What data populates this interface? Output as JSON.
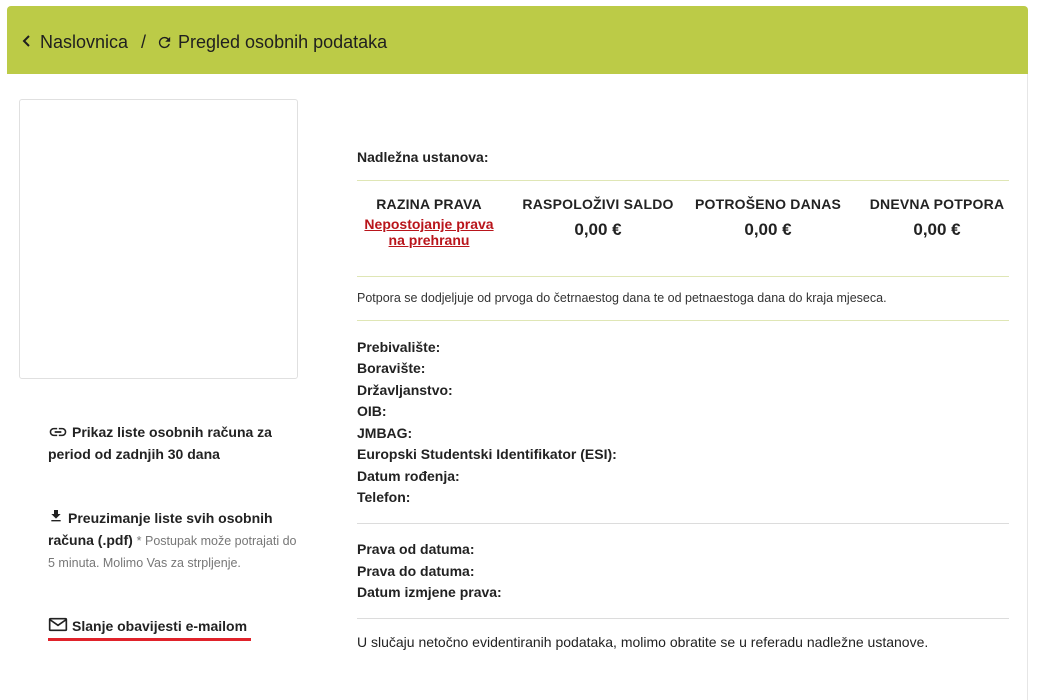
{
  "breadcrumb": {
    "home": "Naslovnica",
    "separator": "/",
    "current": "Pregled osobnih podataka"
  },
  "colors": {
    "header_bg": "#bccb47",
    "accent_red": "#b9151b"
  },
  "sidebar": {
    "link1": "Prikaz liste osobnih računa za period od zadnjih 30 dana",
    "link2": "Preuzimanje liste svih osobnih računa (.pdf)",
    "link2_note": "* Postupak može potrajati do 5 minuta. Molimo Vas za strpljenje.",
    "link3": "Slanje obavijesti e-mailom"
  },
  "main": {
    "institution_label": "Nadležna ustanova:",
    "columns": [
      {
        "title": "RAZINA PRAVA",
        "value": "Nepostojanje prava na prehranu"
      },
      {
        "title": "RASPOLOŽIVI SALDO",
        "value": "0,00 €"
      },
      {
        "title": "POTROŠENO DANAS",
        "value": "0,00 €"
      },
      {
        "title": "DNEVNA POTPORA",
        "value": "0,00 €"
      }
    ],
    "support_info": "Potpora se dodjeljuje od prvoga do četrnaestog dana te od petnaestoga dana do kraja mjeseca.",
    "personal_fields": [
      "Prebivalište:",
      "Boravište:",
      "Državljanstvo:",
      "OIB:",
      "JMBAG:",
      "Europski Studentski Identifikator (ESI):",
      "Datum rođenja:",
      "Telefon:"
    ],
    "rights_fields": [
      "Prava od datuma:",
      "Prava do datuma:",
      "Datum izmjene prava:"
    ],
    "footer_note": "U slučaju netočno evidentiranih podataka, molimo obratite se u referadu nadležne ustanove."
  }
}
